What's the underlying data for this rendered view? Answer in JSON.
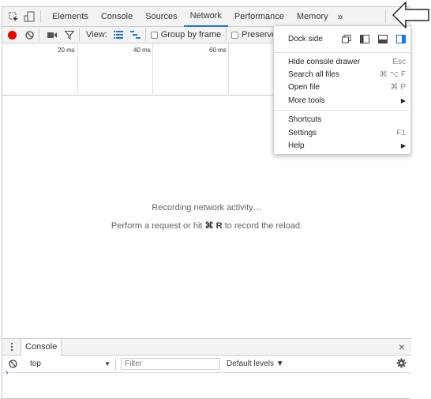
{
  "tabbar": {
    "tabs": [
      "Elements",
      "Console",
      "Sources",
      "Network",
      "Performance",
      "Memory"
    ],
    "active": "Network",
    "overflow": "»",
    "more_icon": "kebab-menu-icon"
  },
  "network_toolbar": {
    "view_label": "View:",
    "group_by_frame": "Group by frame",
    "preserve_log": "Preserve"
  },
  "overview": {
    "labels": [
      "20 ms",
      "40 ms",
      "60 ms"
    ]
  },
  "main": {
    "recording_text": "Recording network activity…",
    "hint_prefix": "Perform a request or hit",
    "hint_key": "⌘ R",
    "hint_suffix": "to record the reload."
  },
  "drawer": {
    "tab_label": "Console",
    "close": "×",
    "context": "top",
    "context_arrow": "▼",
    "filter_placeholder": "Filter",
    "levels": "Default levels ▼",
    "prompt": "›"
  },
  "menu": {
    "dock_side": "Dock side",
    "items": [
      {
        "label": "Hide console drawer",
        "shortcut": "Esc"
      },
      {
        "label": "Search all files",
        "shortcut": "⌘ ⌥ F"
      },
      {
        "label": "Open file",
        "shortcut": "⌘ P"
      },
      {
        "label": "More tools",
        "shortcut": "▶"
      },
      {
        "label": "Shortcuts",
        "shortcut": ""
      },
      {
        "label": "Settings",
        "shortcut": "F1"
      },
      {
        "label": "Help",
        "shortcut": "▶"
      }
    ]
  },
  "colors": {
    "accent": "#1a73e8",
    "record": "#ea0000"
  }
}
